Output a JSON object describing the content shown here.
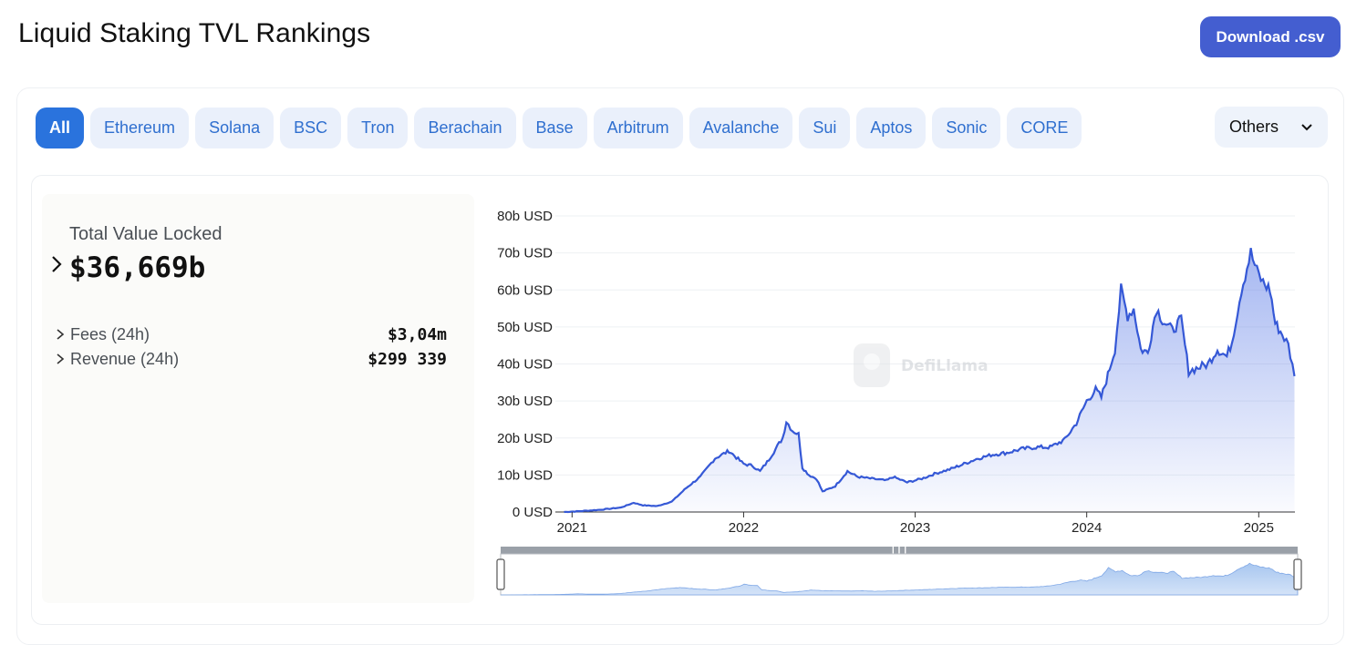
{
  "header": {
    "title": "Liquid Staking TVL Rankings",
    "download_label": "Download .csv"
  },
  "chain_tabs": [
    {
      "label": "All",
      "active": true
    },
    {
      "label": "Ethereum"
    },
    {
      "label": "Solana"
    },
    {
      "label": "BSC"
    },
    {
      "label": "Tron"
    },
    {
      "label": "Berachain"
    },
    {
      "label": "Base"
    },
    {
      "label": "Arbitrum"
    },
    {
      "label": "Avalanche"
    },
    {
      "label": "Sui"
    },
    {
      "label": "Aptos"
    },
    {
      "label": "Sonic"
    },
    {
      "label": "CORE"
    }
  ],
  "others_dropdown": {
    "label": "Others",
    "icon": "chevron-down-icon"
  },
  "summary": {
    "tvl_label": "Total Value Locked",
    "tvl_value": "$36,669b",
    "fees_label": "Fees (24h)",
    "fees_value": "$3,04m",
    "revenue_label": "Revenue (24h)",
    "revenue_value": "$299 339"
  },
  "watermark": {
    "text": "DefiLlama"
  },
  "colors": {
    "accent": "#445ed0",
    "tab_active": "#2a73dd",
    "tab_bg": "#eaf0fb",
    "tab_text": "#2f6fcf",
    "line": "#3558d6"
  },
  "chart_data": {
    "type": "area",
    "title": "",
    "xlabel": "",
    "ylabel": "",
    "unit": "USD",
    "ylim": [
      0,
      80
    ],
    "y_ticks": [
      "0 USD",
      "10b USD",
      "20b USD",
      "30b USD",
      "40b USD",
      "50b USD",
      "60b USD",
      "70b USD",
      "80b USD"
    ],
    "x_ticks": [
      "2021",
      "2022",
      "2023",
      "2024",
      "2025"
    ],
    "grid": true,
    "legend": "none",
    "series": [
      {
        "values_in_billions_by_date": [
          [
            "2020-12-15",
            0
          ],
          [
            "2021-01-15",
            0.2
          ],
          [
            "2021-03-01",
            0.6
          ],
          [
            "2021-04-15",
            1.2
          ],
          [
            "2021-05-12",
            2.5
          ],
          [
            "2021-06-01",
            1.8
          ],
          [
            "2021-07-01",
            1.6
          ],
          [
            "2021-08-01",
            2.8
          ],
          [
            "2021-09-01",
            6.5
          ],
          [
            "2021-10-01",
            9.5
          ],
          [
            "2021-11-01",
            14.5
          ],
          [
            "2021-12-01",
            16.5
          ],
          [
            "2022-01-01",
            13
          ],
          [
            "2022-01-20",
            12.5
          ],
          [
            "2022-02-05",
            11
          ],
          [
            "2022-02-20",
            13.5
          ],
          [
            "2022-03-10",
            17
          ],
          [
            "2022-03-25",
            20
          ],
          [
            "2022-04-02",
            24.5
          ],
          [
            "2022-04-15",
            22
          ],
          [
            "2022-04-28",
            21
          ],
          [
            "2022-05-06",
            12
          ],
          [
            "2022-05-20",
            10
          ],
          [
            "2022-06-05",
            9
          ],
          [
            "2022-06-18",
            5.5
          ],
          [
            "2022-07-15",
            7
          ],
          [
            "2022-08-10",
            11
          ],
          [
            "2022-09-01",
            9.5
          ],
          [
            "2022-10-01",
            9
          ],
          [
            "2022-11-01",
            8.5
          ],
          [
            "2022-11-15",
            9.5
          ],
          [
            "2022-12-15",
            8
          ],
          [
            "2023-01-15",
            9
          ],
          [
            "2023-02-15",
            10.5
          ],
          [
            "2023-03-15",
            11.5
          ],
          [
            "2023-04-15",
            13
          ],
          [
            "2023-05-15",
            14.5
          ],
          [
            "2023-06-15",
            15.5
          ],
          [
            "2023-07-15",
            16
          ],
          [
            "2023-08-15",
            17
          ],
          [
            "2023-09-15",
            17.5
          ],
          [
            "2023-10-15",
            17.5
          ],
          [
            "2023-11-15",
            19.5
          ],
          [
            "2023-12-10",
            24
          ],
          [
            "2024-01-01",
            30
          ],
          [
            "2024-01-20",
            33
          ],
          [
            "2024-02-01",
            31
          ],
          [
            "2024-02-15",
            37
          ],
          [
            "2024-03-01",
            44
          ],
          [
            "2024-03-14",
            60
          ],
          [
            "2024-03-28",
            53
          ],
          [
            "2024-04-10",
            55
          ],
          [
            "2024-04-25",
            44
          ],
          [
            "2024-05-10",
            43
          ],
          [
            "2024-05-28",
            55
          ],
          [
            "2024-06-10",
            52
          ],
          [
            "2024-07-01",
            49
          ],
          [
            "2024-07-20",
            52
          ],
          [
            "2024-08-05",
            38
          ],
          [
            "2024-08-25",
            39
          ],
          [
            "2024-09-15",
            40
          ],
          [
            "2024-10-05",
            44
          ],
          [
            "2024-10-25",
            42
          ],
          [
            "2024-11-05",
            46
          ],
          [
            "2024-11-25",
            60
          ],
          [
            "2024-12-15",
            70
          ],
          [
            "2024-12-28",
            65
          ],
          [
            "2025-01-10",
            62
          ],
          [
            "2025-01-25",
            60
          ],
          [
            "2025-02-05",
            51
          ],
          [
            "2025-02-20",
            48
          ],
          [
            "2025-03-05",
            45
          ],
          [
            "2025-03-18",
            36.7
          ]
        ]
      }
    ]
  }
}
